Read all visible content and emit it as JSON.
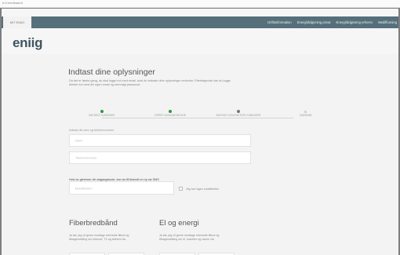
{
  "browser": {
    "url": "b.fr.bredbaand"
  },
  "nav": {
    "my_card": "MIT ENIIG",
    "links": [
      "Driftsinformation",
      "Energirådgivning privat",
      "Energirådgivning erhverv",
      "Mediffunning"
    ]
  },
  "brand": {
    "logo": "eniig"
  },
  "form": {
    "title": "Indtast dine oplysninger",
    "intro": "Da det er første gang, du skal logge ind med email, skal du indtaste dine oplysninger nedenfor. Efterfølgende kan du logge direkte ind med din egen email og selvvalgt password.",
    "steps": [
      "INDTAST KUNDENR.",
      "OPRET ADGANGSKODE",
      "INDTAST KONTAKTOPLYSNINGER",
      "INDSEND"
    ],
    "hint": "Indtast dit navn og telefonnummer",
    "name_placeholder": "Navn",
    "phone_placeholder": "Telefonnummer",
    "note": "Hvis du glemmer din adgangskode, kan du få tilsendt en ny via SMS",
    "mobile_placeholder": "Mobiltelefon",
    "no_mobile_label": "Jeg har ingen mobiltelefon"
  },
  "sections": {
    "fiber": {
      "title": "Fiberbredbånd",
      "text": "Ja tak, jeg vil gerne modtage relevante tilbud og tilbagemelding om Internet, TV og telefoni via"
    },
    "energy": {
      "title": "El og energi",
      "text": "Ja tak, jeg vil gerne modtage relevante tilbud og tilbagemelding om el, solceller og varme via"
    }
  },
  "colors": {
    "nav": "#56707b",
    "logo": "#3f5660",
    "step_done": "#2e9a3a",
    "step_current": "#777777"
  }
}
